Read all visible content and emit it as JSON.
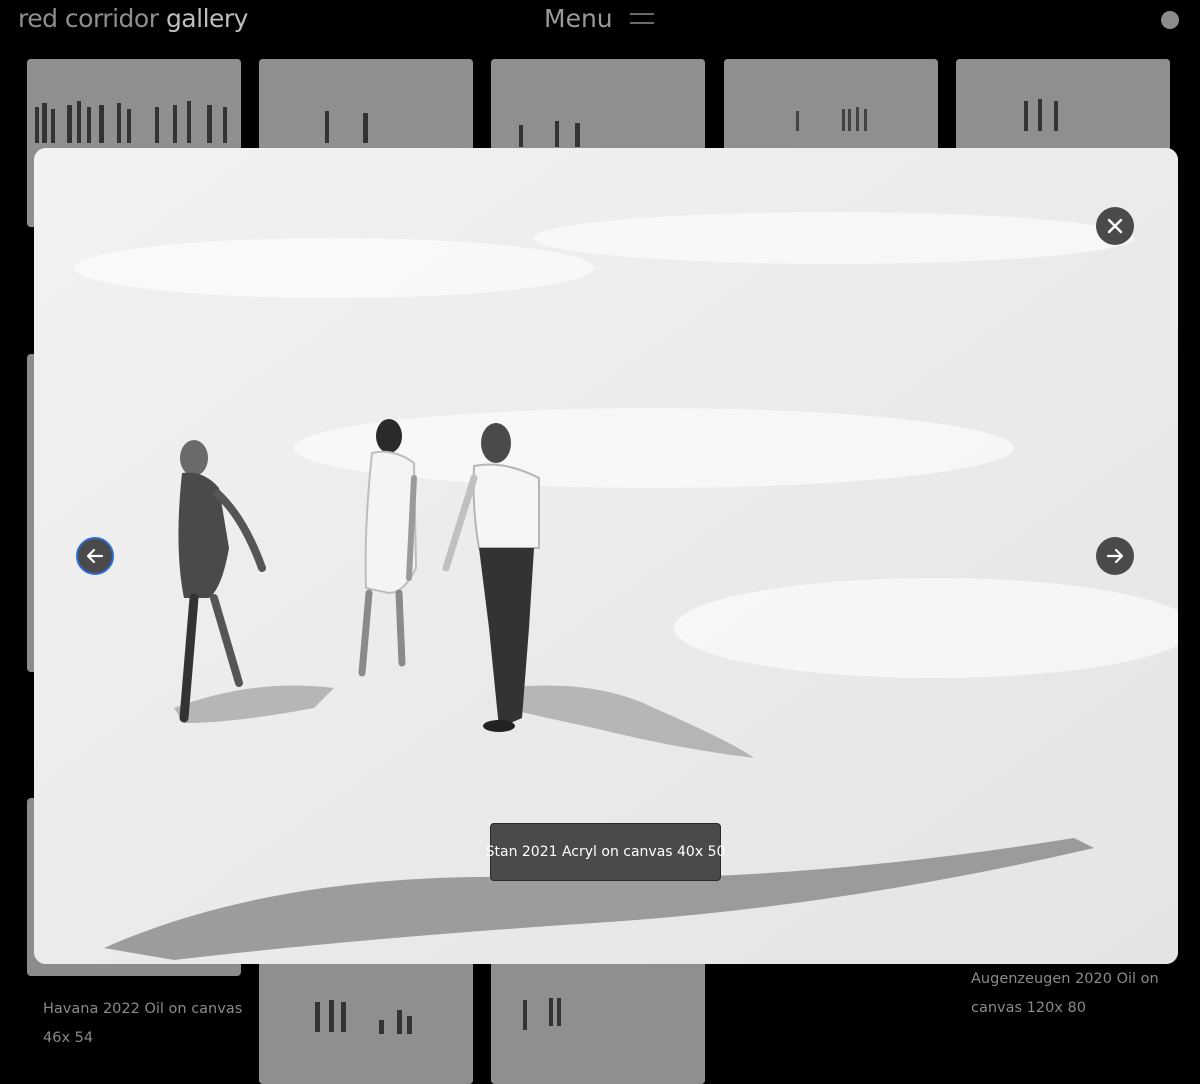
{
  "header": {
    "brand_light": "red corridor",
    "brand_bold": "gallery",
    "menu_label": "Menu"
  },
  "gallery": {
    "captions": [
      {
        "line1": "Havana 2022 Oil on canvas",
        "line2": "46x 54"
      },
      {
        "line1": "Augenzeugen 2020 Oil on",
        "line2": "canvas 120x 80"
      }
    ]
  },
  "lightbox": {
    "caption": "Stan 2021 Acryl on canvas 40x 50",
    "close_icon": "close-icon",
    "prev_icon": "arrow-left-icon",
    "next_icon": "arrow-right-icon"
  },
  "colors": {
    "focus_ring": "#2e6bd6",
    "button_bg": "#4a4a4a"
  }
}
